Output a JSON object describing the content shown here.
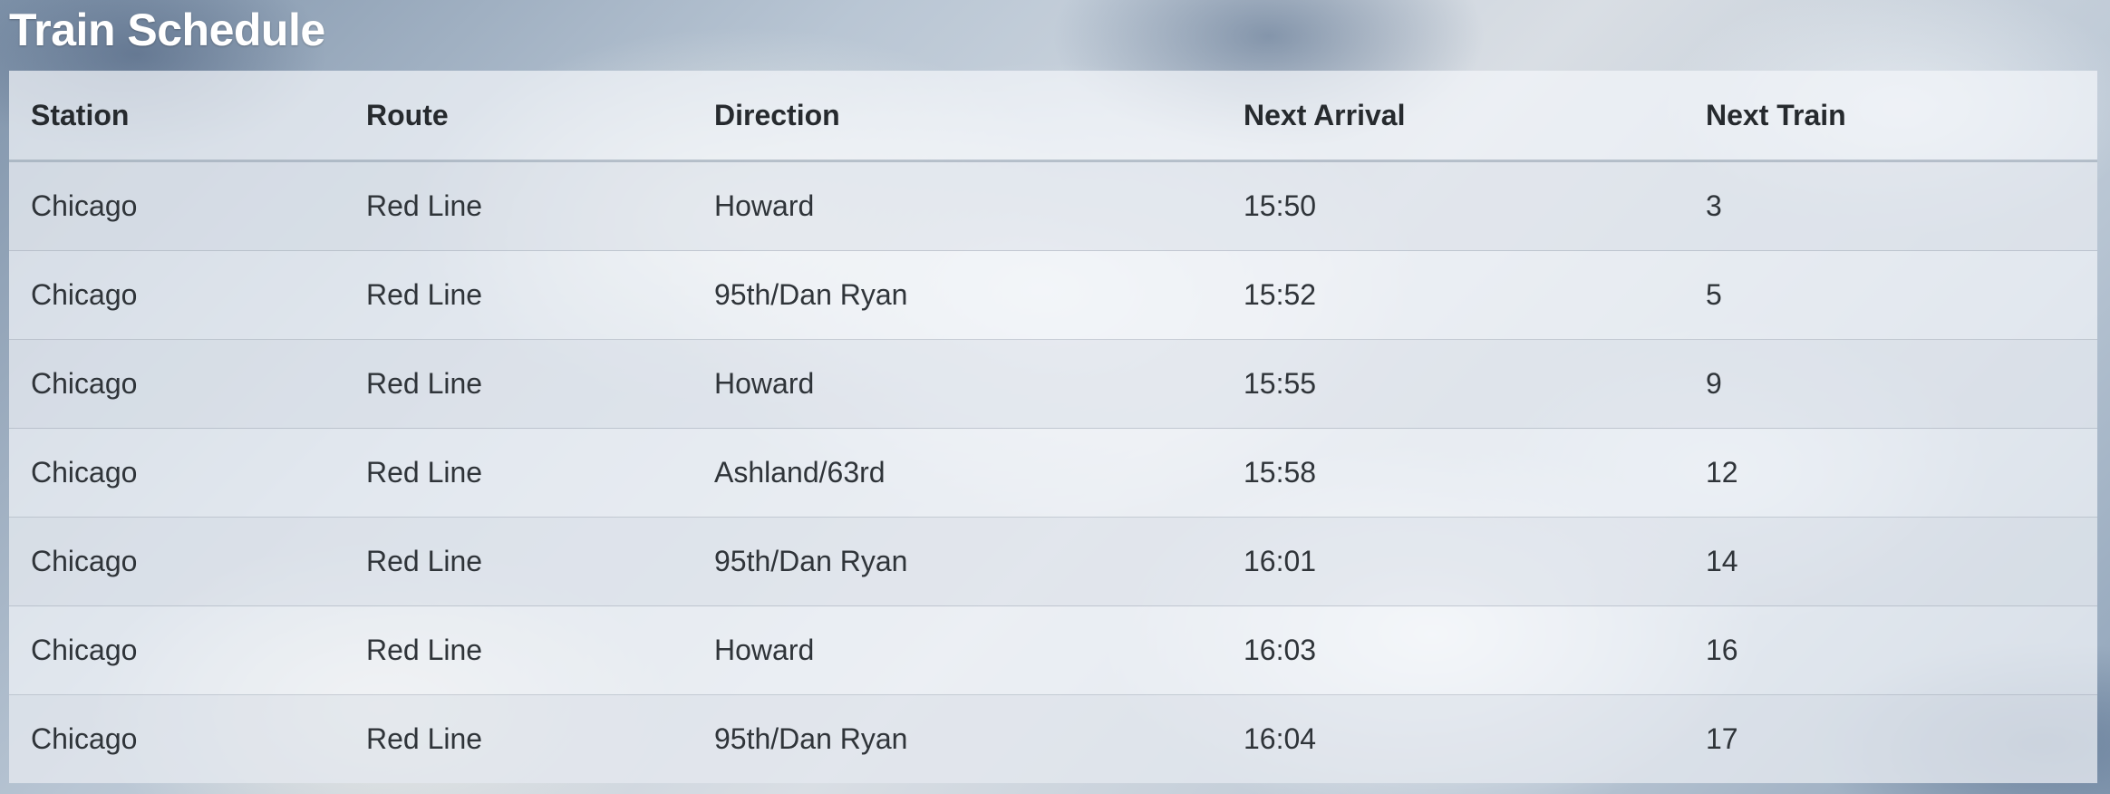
{
  "page": {
    "title": "Train Schedule"
  },
  "table": {
    "headers": {
      "station": "Station",
      "route": "Route",
      "direction": "Direction",
      "next_arrival": "Next Arrival",
      "next_train": "Next Train"
    },
    "rows": [
      {
        "station": "Chicago",
        "route": "Red Line",
        "direction": "Howard",
        "next_arrival": "15:50",
        "next_train": "3"
      },
      {
        "station": "Chicago",
        "route": "Red Line",
        "direction": "95th/Dan Ryan",
        "next_arrival": "15:52",
        "next_train": "5"
      },
      {
        "station": "Chicago",
        "route": "Red Line",
        "direction": "Howard",
        "next_arrival": "15:55",
        "next_train": "9"
      },
      {
        "station": "Chicago",
        "route": "Red Line",
        "direction": "Ashland/63rd",
        "next_arrival": "15:58",
        "next_train": "12"
      },
      {
        "station": "Chicago",
        "route": "Red Line",
        "direction": "95th/Dan Ryan",
        "next_arrival": "16:01",
        "next_train": "14"
      },
      {
        "station": "Chicago",
        "route": "Red Line",
        "direction": "Howard",
        "next_arrival": "16:03",
        "next_train": "16"
      },
      {
        "station": "Chicago",
        "route": "Red Line",
        "direction": "95th/Dan Ryan",
        "next_arrival": "16:04",
        "next_train": "17"
      }
    ]
  }
}
